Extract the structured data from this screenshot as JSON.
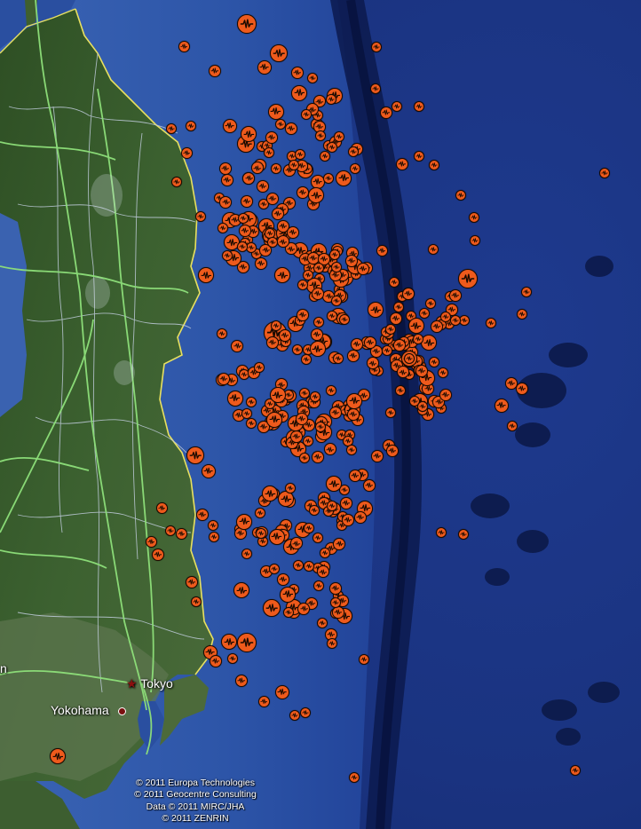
{
  "map": {
    "colors": {
      "ocean_deep": "#14266e",
      "ocean_shelf": "#2a4fa0",
      "land": "#355a26",
      "roads": "#8ee07a",
      "borders": "#b8c4d6",
      "coast": "#e8e060",
      "marker": "#ee5a1c"
    },
    "marker_icon": "seismic-wave-icon",
    "cities": [
      {
        "name": "Tokyo",
        "icon": "star-icon"
      },
      {
        "name": "Yokohama",
        "icon": "dot-icon"
      }
    ],
    "partial_left_label": "n",
    "credits": [
      "© 2011 Europa Technologies",
      "© 2011 Geocentre Consulting",
      "Data © 2011 MIRC/JHA",
      "© 2011 ZENRIN"
    ]
  }
}
